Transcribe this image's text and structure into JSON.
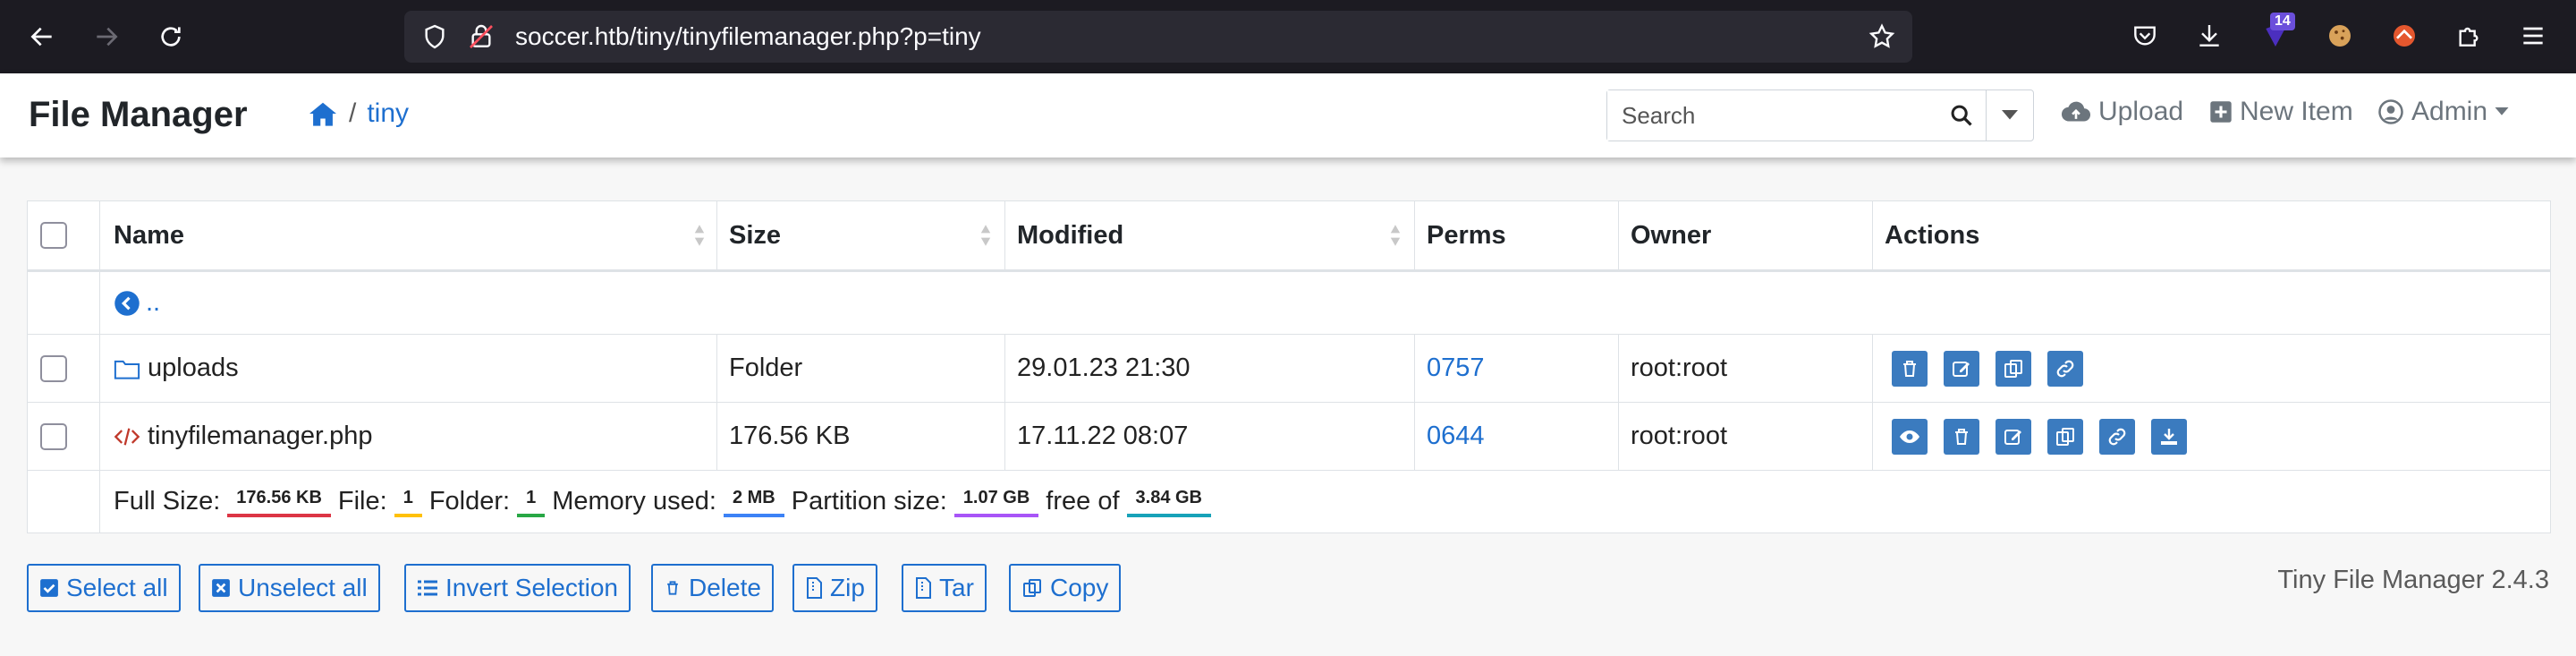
{
  "browser": {
    "url": "soccer.htb/tiny/tinyfilemanager.php?p=tiny",
    "extension_badge": "14"
  },
  "app": {
    "brand": "File Manager",
    "breadcrumb": {
      "separator": "/",
      "current": "tiny"
    },
    "search_placeholder": "Search",
    "nav": {
      "upload": "Upload",
      "new_item": "New Item",
      "admin": "Admin"
    }
  },
  "table": {
    "headers": {
      "name": "Name",
      "size": "Size",
      "modified": "Modified",
      "perms": "Perms",
      "owner": "Owner",
      "actions": "Actions"
    },
    "parent_link": "..",
    "rows": [
      {
        "name": "uploads",
        "size": "Folder",
        "modified": "29.01.23 21:30",
        "perms": "0757",
        "owner": "root:root"
      },
      {
        "name": "tinyfilemanager.php",
        "size": "176.56 KB",
        "modified": "17.11.22 08:07",
        "perms": "0644",
        "owner": "root:root"
      }
    ],
    "footer": {
      "full_size_label": "Full Size:",
      "full_size": "176.56 KB",
      "file_label": "File:",
      "file_count": "1",
      "folder_label": "Folder:",
      "folder_count": "1",
      "memory_label": "Memory used:",
      "memory": "2 MB",
      "partition_label": "Partition size:",
      "partition": "1.07 GB",
      "free_label": "free of",
      "free_of": "3.84 GB"
    }
  },
  "buttons": {
    "select_all": "Select all",
    "unselect_all": "Unselect all",
    "invert": "Invert Selection",
    "delete": "Delete",
    "zip": "Zip",
    "tar": "Tar",
    "copy": "Copy"
  },
  "version": "Tiny File Manager 2.4.3",
  "colors": {
    "accent": "#1e6fcf",
    "action_button": "#3b7bbf",
    "badge_full_size": "#dc3545",
    "badge_file": "#ffc107",
    "badge_folder": "#28a745",
    "badge_memory": "#3c82f6",
    "badge_partition": "#a855f7",
    "badge_free": "#17a2b8"
  }
}
